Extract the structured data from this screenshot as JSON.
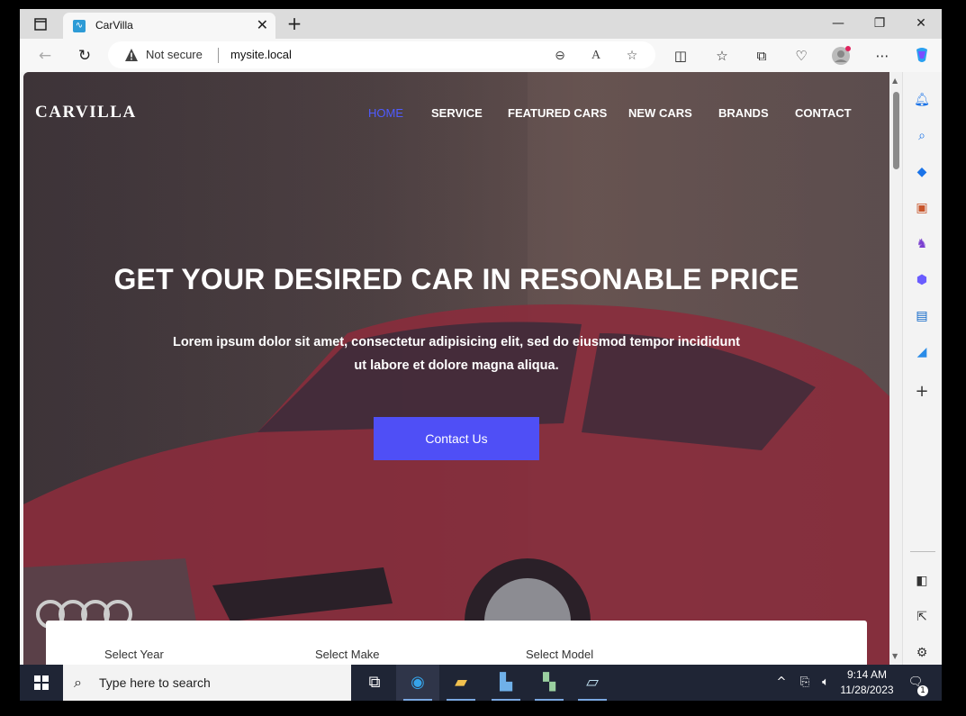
{
  "browser": {
    "tab_title": "CarVilla",
    "not_secure": "Not secure",
    "url": "mysite.local"
  },
  "site": {
    "brand": "CARVILLA",
    "menu": [
      "HOME",
      "SERVICE",
      "FEATURED CARS",
      "NEW CARS",
      "BRANDS",
      "CONTACT"
    ],
    "active_menu": "HOME",
    "headline": "GET YOUR DESIRED CAR IN RESONABLE PRICE",
    "lead": "Lorem ipsum dolor sit amet, consectetur adipisicing elit, sed do eiusmod tempor incididunt ut labore et dolore magna aliqua.",
    "cta": "Contact Us",
    "search_fields": [
      "Select Year",
      "Select Make",
      "Select Model"
    ]
  },
  "colors": {
    "accent": "#4f4ff6",
    "active_menu": "#4f5bff",
    "taskbar": "#1f2535"
  },
  "taskbar": {
    "search_placeholder": "Type here to search",
    "time": "9:14 AM",
    "date": "11/28/2023",
    "notification_count": "1"
  }
}
